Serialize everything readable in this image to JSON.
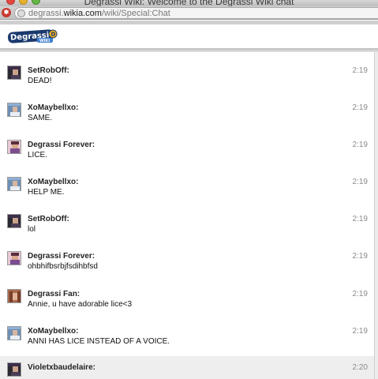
{
  "window": {
    "title": "Degrassi Wiki: Welcome to the Degrassi Wiki chat"
  },
  "address": {
    "url_prefix": "degrassi.",
    "url_domain": "wikia.com",
    "url_path": "/wiki/Special:Chat"
  },
  "header": {
    "logo_text": "Degrassi",
    "logo_badge": "WIKI"
  },
  "messages": [
    {
      "user": "SetRobOff:",
      "text": "DEAD!",
      "time": "2:19",
      "avatar": "avatar-dark"
    },
    {
      "user": "XoMaybellxo:",
      "text": "SAME.",
      "time": "2:19",
      "avatar": "avatar-blue"
    },
    {
      "user": "Degrassi Forever:",
      "text": "LICE.",
      "time": "2:19",
      "avatar": "avatar-pink"
    },
    {
      "user": "XoMaybellxo:",
      "text": "HELP ME.",
      "time": "2:19",
      "avatar": "avatar-blue"
    },
    {
      "user": "SetRobOff:",
      "text": "lol",
      "time": "2:19",
      "avatar": "avatar-dark"
    },
    {
      "user": "Degrassi Forever:",
      "text": "ohbhifbsrbjfsdihbfsd",
      "time": "2:19",
      "avatar": "avatar-pink"
    },
    {
      "user": "Degrassi Fan:",
      "text": "Annie, u have adorable lice<3",
      "time": "2:19",
      "avatar": "avatar-girl"
    },
    {
      "user": "XoMaybellxo:",
      "text": "ANNI HAS LICE INSTEAD OF A VOICE.",
      "time": "2:19",
      "avatar": "avatar-blue"
    },
    {
      "user": "Violetxbaudelaire:",
      "text": "",
      "time": "2:20",
      "avatar": "avatar-dark"
    }
  ]
}
